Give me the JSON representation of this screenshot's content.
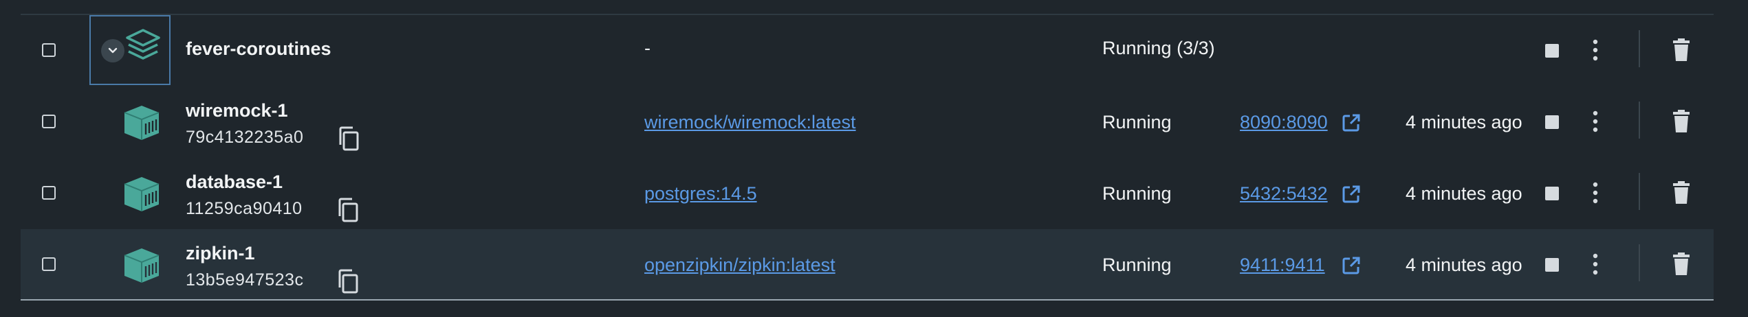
{
  "rows": [
    {
      "name": "fever-coroutines",
      "image": "-",
      "status": "Running (3/3)",
      "group": true
    },
    {
      "name": "wiremock-1",
      "id": "79c4132235a0",
      "image": "wiremock/wiremock:latest",
      "status": "Running",
      "port": "8090:8090",
      "started": "4 minutes ago"
    },
    {
      "name": "database-1",
      "id": "11259ca90410",
      "image": "postgres:14.5",
      "status": "Running",
      "port": "5432:5432",
      "started": "4 minutes ago"
    },
    {
      "name": "zipkin-1",
      "id": "13b5e947523c",
      "image": "openzipkin/zipkin:latest",
      "status": "Running",
      "port": "9411:9411",
      "started": "4 minutes ago"
    }
  ],
  "colors": {
    "background": "#1f262c",
    "link": "#5b9ae6",
    "container_icon": "#4aa89a",
    "selected_row": "#27323a"
  },
  "icons": {
    "stack": "stack-layers-icon",
    "container": "container-icon",
    "copy": "copy-icon",
    "external": "external-link-icon",
    "stop": "stop-icon",
    "more": "more-vertical-icon",
    "delete": "trash-icon",
    "expand": "chevron-down-icon"
  }
}
